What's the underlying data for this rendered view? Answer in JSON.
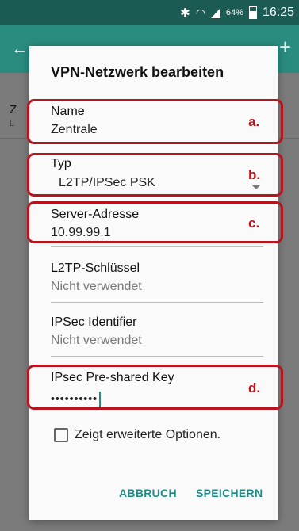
{
  "status_bar": {
    "battery": "64%",
    "battery_level": 0.64,
    "time": "16:25",
    "icons": [
      "bluetooth-icon",
      "wifi-icon",
      "signal-icon",
      "battery-icon"
    ]
  },
  "background": {
    "item_title_partial": "Z",
    "item_sub_partial": "L"
  },
  "dialog": {
    "title": "VPN-Netzwerk bearbeiten",
    "fields": {
      "name": {
        "label": "Name",
        "value": "Zentrale"
      },
      "typ": {
        "label": "Typ",
        "value": "L2TP/IPSec PSK"
      },
      "server": {
        "label": "Server-Adresse",
        "value": "10.99.99.1"
      },
      "l2tp": {
        "label": "L2TP-Schlüssel",
        "placeholder": "Nicht verwendet"
      },
      "ipsec_id": {
        "label": "IPSec Identifier",
        "placeholder": "Nicht verwendet"
      },
      "psk": {
        "label": "IPsec Pre-shared Key",
        "value": "••••••••••"
      }
    },
    "checkbox_label": "Zeigt erweiterte Optionen.",
    "checkbox_checked": false,
    "cancel_label": "ABBRUCH",
    "save_label": "SPEICHERN"
  },
  "annotations": {
    "a": "a.",
    "b": "b.",
    "c": "c.",
    "d": "d."
  },
  "colors": {
    "accent": "#1e8b83",
    "annotation": "#b8141e",
    "appbar": "#2a8c7f",
    "statusbar": "#1b5b53"
  }
}
